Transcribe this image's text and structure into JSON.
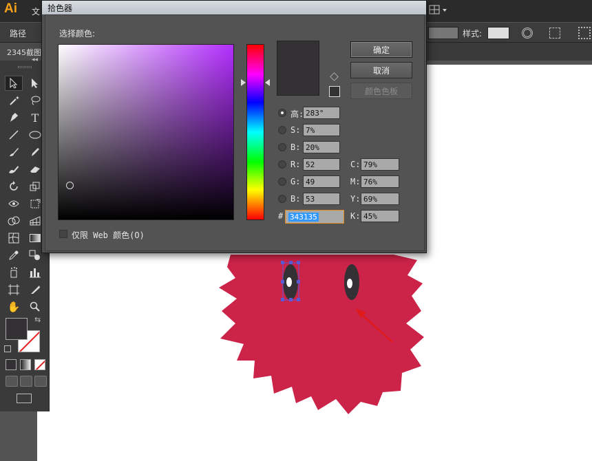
{
  "app": {
    "logo": "Ai",
    "menu_file_partial": "文",
    "control_path_label": "路径",
    "style_label": "样式:",
    "doc_tab_title": "2345截图"
  },
  "toolbox": {
    "collapse_glyph": "◂◂",
    "tools": [
      "selection",
      "direct-selection",
      "magic-wand",
      "lasso",
      "pen",
      "type",
      "line-segment",
      "ellipse",
      "paintbrush",
      "pencil",
      "blob-brush",
      "eraser",
      "rotate",
      "scale",
      "width",
      "free-transform",
      "shape-builder",
      "perspective-grid",
      "mesh",
      "gradient",
      "eyedropper",
      "blend",
      "symbol-sprayer",
      "column-graph",
      "artboard",
      "slice",
      "hand",
      "zoom"
    ],
    "fill_color": "#343135",
    "stroke": "none"
  },
  "color_picker": {
    "title": "拾色器",
    "select_color_label": "选择颜色:",
    "ok_label": "确定",
    "cancel_label": "取消",
    "swatches_label": "颜色色板",
    "hue_base_color": "#b32fff",
    "preview_color": "#343135",
    "hsb": [
      {
        "label": "高:",
        "value": "283°",
        "checked": true
      },
      {
        "label": "S:",
        "value": "7%",
        "checked": false
      },
      {
        "label": "B:",
        "value": "20%",
        "checked": false
      }
    ],
    "rgb": [
      {
        "label": "R:",
        "value": "52",
        "checked": false
      },
      {
        "label": "G:",
        "value": "49",
        "checked": false
      },
      {
        "label": "B:",
        "value": "53",
        "checked": false
      }
    ],
    "cmyk": [
      {
        "label": "C:",
        "value": "79%"
      },
      {
        "label": "M:",
        "value": "76%"
      },
      {
        "label": "Y:",
        "value": "69%"
      },
      {
        "label": "K:",
        "value": "45%"
      }
    ],
    "hex_label": "#",
    "hex_value": "343135",
    "web_only_label": "仅限 Web 颜色(O)",
    "web_only_checked": false
  },
  "artwork": {
    "creature_color": "#cc2349",
    "eye_color": "#343135",
    "pupil_color": "#ffffff",
    "selection_color": "#5b5bd6",
    "arrow_color": "#e01a1a"
  }
}
